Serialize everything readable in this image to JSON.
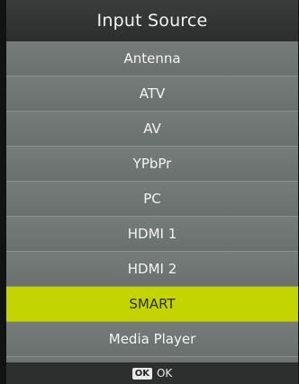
{
  "menu": {
    "title": "Input Source",
    "items": [
      {
        "label": "Antenna"
      },
      {
        "label": "ATV"
      },
      {
        "label": "AV"
      },
      {
        "label": "YPbPr"
      },
      {
        "label": "PC"
      },
      {
        "label": "HDMI 1"
      },
      {
        "label": "HDMI 2"
      },
      {
        "label": "SMART"
      },
      {
        "label": "Media Player"
      }
    ],
    "selected_index": 7
  },
  "footer": {
    "ok_key": "OK",
    "ok_label": "OK"
  },
  "colors": {
    "highlight": "#c3d400",
    "panel": "#6c726f",
    "header": "#2b2e2d"
  }
}
